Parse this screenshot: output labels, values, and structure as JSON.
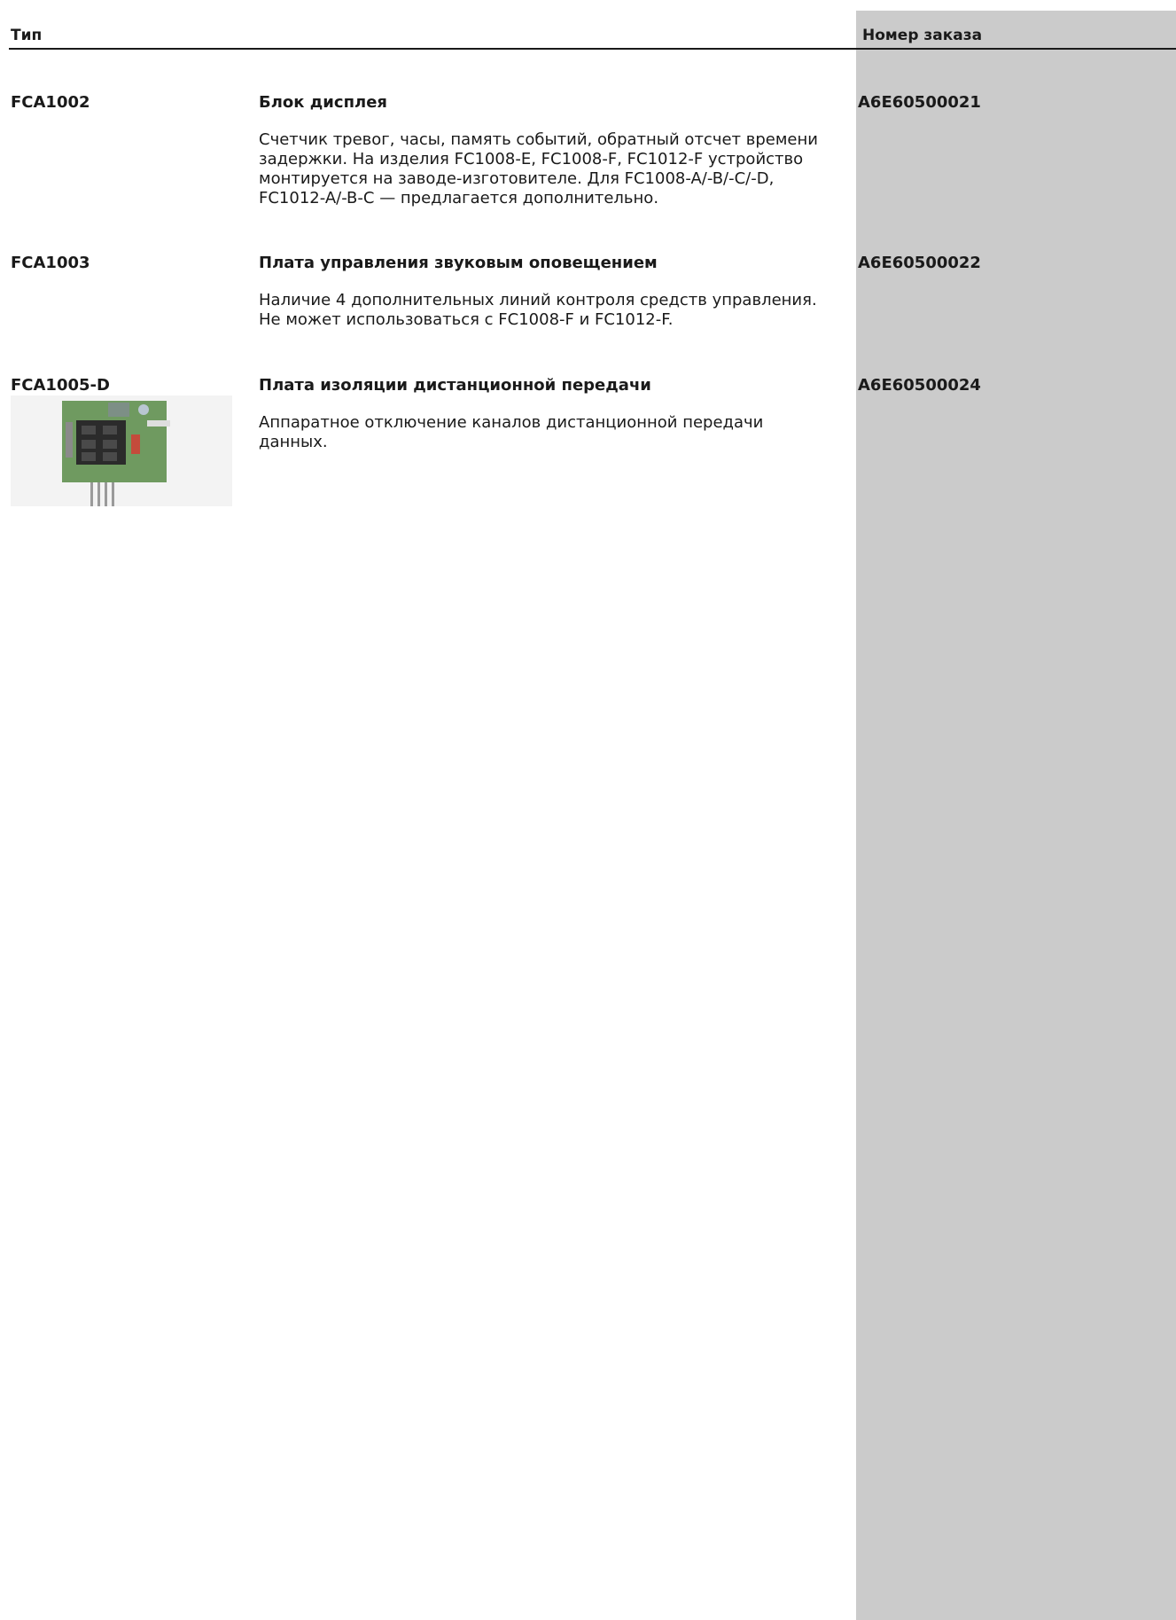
{
  "header": {
    "type_label": "Тип",
    "order_label": "Номер заказа"
  },
  "items": [
    {
      "type": "FCA1002",
      "title": "Блок дисплея",
      "description_lines": [
        "Счетчик тревог, часы, память событий, обратный отсчет времени",
        "задержки. На изделия FC1008-E, FC1008-F, FC1012-F устройство",
        "монтируется на заводе-изготовителе. Для FC1008-A/-B/-C/-D,",
        "FC1012-A/-B-C — предлагается дополнительно."
      ],
      "order": "A6E60500021"
    },
    {
      "type": "FCA1003",
      "title": "Плата управления звуковым оповещением",
      "description_lines": [
        "Наличие 4 дополнительных линий контроля средств управления.",
        "Не может использоваться с FC1008-F и FC1012-F."
      ],
      "order": "A6E60500022"
    },
    {
      "type": "FCA1005-D",
      "title": "Плата изоляции дистанционной передачи",
      "description_lines": [
        "Аппаратное отключение каналов дистанционной передачи",
        "данных."
      ],
      "order": "A6E60500024"
    }
  ]
}
